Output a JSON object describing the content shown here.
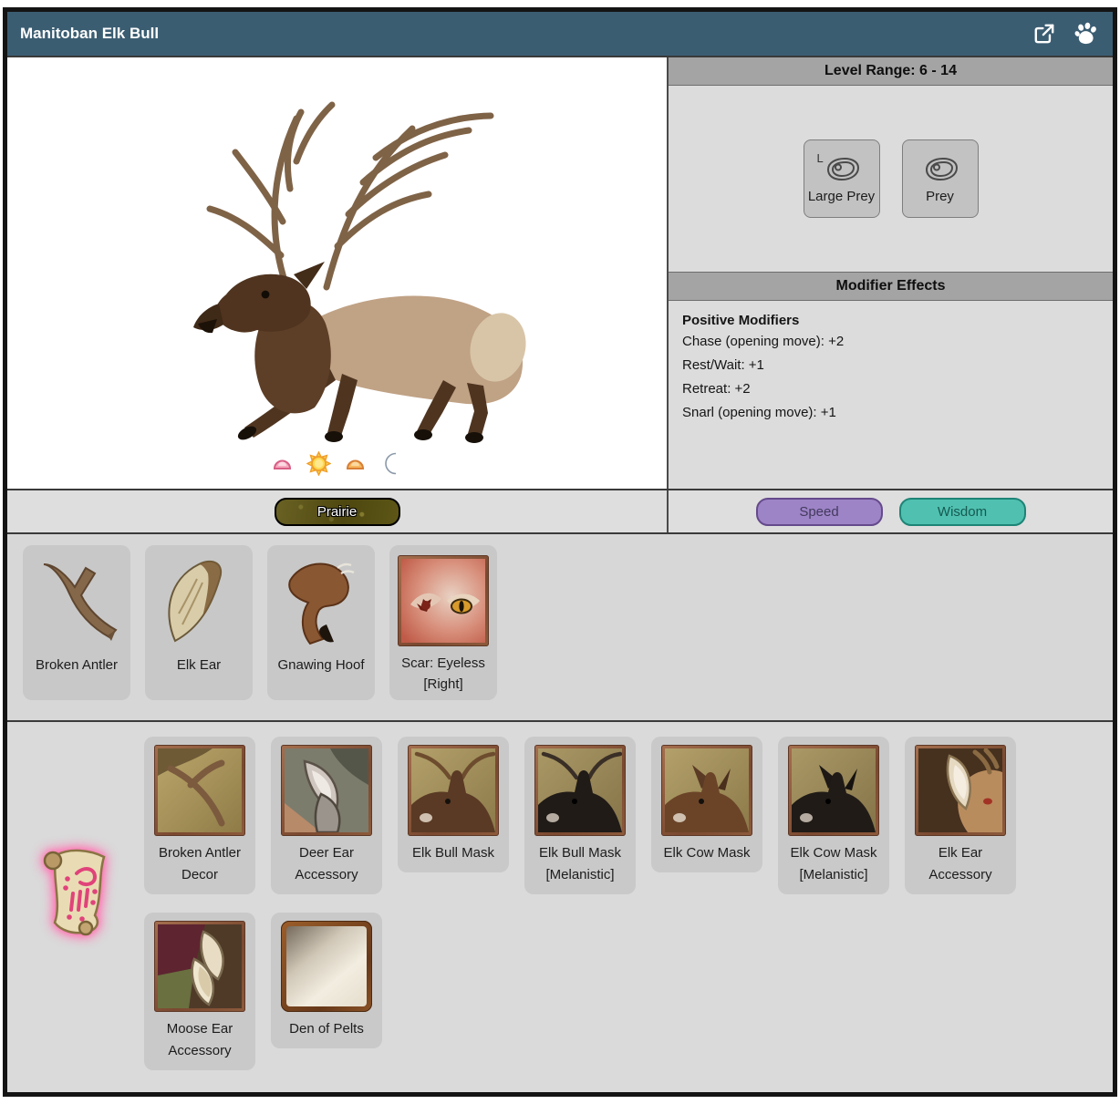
{
  "header": {
    "title": "Manitoban Elk Bull",
    "icons": [
      "external-link-icon",
      "paw-icon"
    ]
  },
  "level_panel": {
    "title": "Level Range: 6 - 14",
    "prey": [
      {
        "label": "Large Prey",
        "badge": "L",
        "icon": "steak-icon"
      },
      {
        "label": "Prey",
        "badge": "",
        "icon": "steak-icon"
      }
    ]
  },
  "modifier_panel": {
    "title": "Modifier Effects",
    "group_title": "Positive Modifiers",
    "items": [
      "Chase (opening move): +2",
      "Rest/Wait: +1",
      "Retreat: +2",
      "Snarl (opening move): +1"
    ]
  },
  "time_of_day": [
    {
      "name": "dawn"
    },
    {
      "name": "day"
    },
    {
      "name": "dusk"
    },
    {
      "name": "night"
    }
  ],
  "habitat": {
    "label": "Prairie"
  },
  "stats": {
    "speed": "Speed",
    "wisdom": "Wisdom"
  },
  "drops": {
    "items": [
      {
        "label": "Broken Antler"
      },
      {
        "label": "Elk Ear"
      },
      {
        "label": "Gnawing Hoof"
      },
      {
        "label": "Scar: Eyeless [Right]"
      }
    ]
  },
  "craftables": {
    "items": [
      {
        "label": "Broken Antler Decor"
      },
      {
        "label": "Deer Ear Accessory"
      },
      {
        "label": "Elk Bull Mask"
      },
      {
        "label": "Elk Bull Mask [Melanistic]"
      },
      {
        "label": "Elk Cow Mask"
      },
      {
        "label": "Elk Cow Mask [Melanistic]"
      },
      {
        "label": "Elk Ear Accessory"
      },
      {
        "label": "Moose Ear Accessory"
      },
      {
        "label": "Den of Pelts"
      }
    ]
  },
  "colors": {
    "header_bg": "#3b5d72",
    "speed_fill": "#9d84c6",
    "speed_border": "#654a8c",
    "wisdom_fill": "#50c1b1",
    "wisdom_border": "#1e8476",
    "section_header_bg": "#a4a4a4",
    "habitat_fill": "#565010"
  }
}
